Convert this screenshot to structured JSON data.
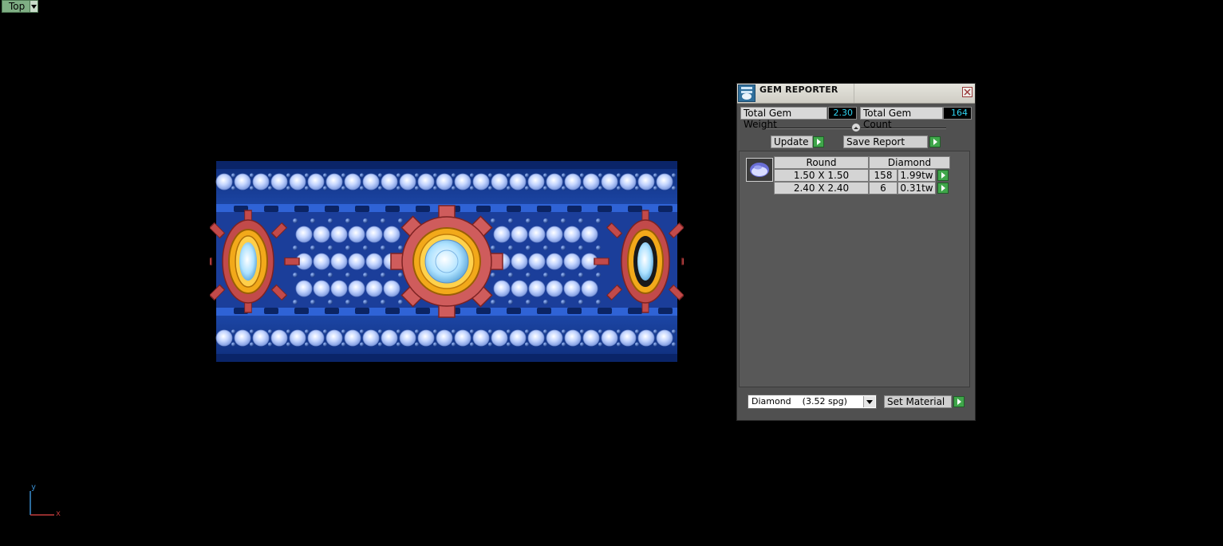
{
  "viewport": {
    "view_label": "Top",
    "axis": {
      "x": "x",
      "y": "y"
    }
  },
  "gem_reporter": {
    "title": "GEM REPORTER",
    "total_weight_label": "Total Gem Weight",
    "total_weight_value": "2.30",
    "total_count_label": "Total Gem Count",
    "total_count_value": "164",
    "update_button": "Update",
    "save_report_button": "Save Report",
    "table": {
      "headers": {
        "shape": "Round",
        "material": "Diamond"
      },
      "rows": [
        {
          "size": "1.50 X 1.50",
          "count": "158",
          "weight": "1.99tw"
        },
        {
          "size": "2.40 X 2.40",
          "count": "6",
          "weight": "0.31tw"
        }
      ]
    },
    "material_select": {
      "value": "Diamond",
      "density": "(3.52 spg)"
    },
    "set_material_button": "Set Material"
  },
  "colors": {
    "metal_blue": "#1f4fc0",
    "gear_red": "#c24a4a",
    "gold": "#f2a91a",
    "diamond": "#b7ccff",
    "panel_bg": "#505050",
    "value_text": "#2fd3f0",
    "go_green": "#3fa64a"
  }
}
